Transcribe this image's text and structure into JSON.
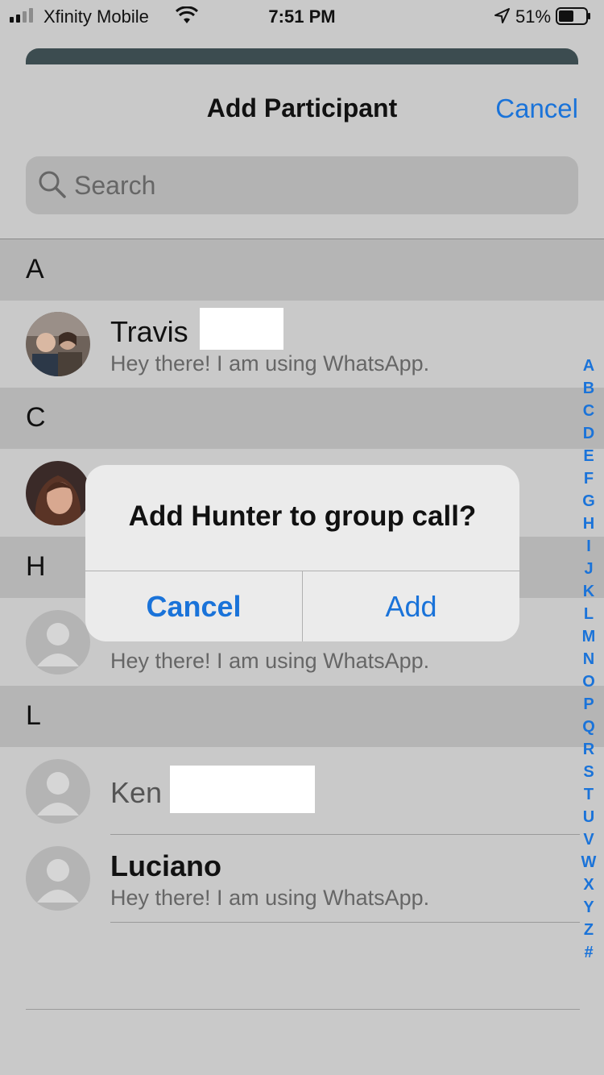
{
  "status_bar": {
    "carrier": "Xfinity Mobile",
    "time": "7:51 PM",
    "battery": "51%"
  },
  "header": {
    "title": "Add Participant",
    "cancel_label": "Cancel"
  },
  "search": {
    "placeholder": "Search"
  },
  "sections": [
    {
      "letter": "A"
    },
    {
      "letter": "C"
    },
    {
      "letter": "H"
    },
    {
      "letter": "L"
    }
  ],
  "contacts": {
    "travis": {
      "name": "Travis ",
      "status": "Hey there! I am using WhatsApp."
    },
    "hunter": {
      "status": "Hey there! I am using WhatsApp."
    },
    "ken": {
      "name": "Ken"
    },
    "luciano": {
      "name": "Luciano",
      "status": "Hey there! I am using WhatsApp."
    }
  },
  "index_letters": [
    "A",
    "B",
    "C",
    "D",
    "E",
    "F",
    "G",
    "H",
    "I",
    "J",
    "K",
    "L",
    "M",
    "N",
    "O",
    "P",
    "Q",
    "R",
    "S",
    "T",
    "U",
    "V",
    "W",
    "X",
    "Y",
    "Z",
    "#"
  ],
  "alert": {
    "title": "Add Hunter to group call?",
    "cancel_label": "Cancel",
    "add_label": "Add"
  },
  "colors": {
    "accent": "#1a73d9",
    "section_bg": "#b5b5b5",
    "dimmed_bg": "#c9c9c9"
  }
}
